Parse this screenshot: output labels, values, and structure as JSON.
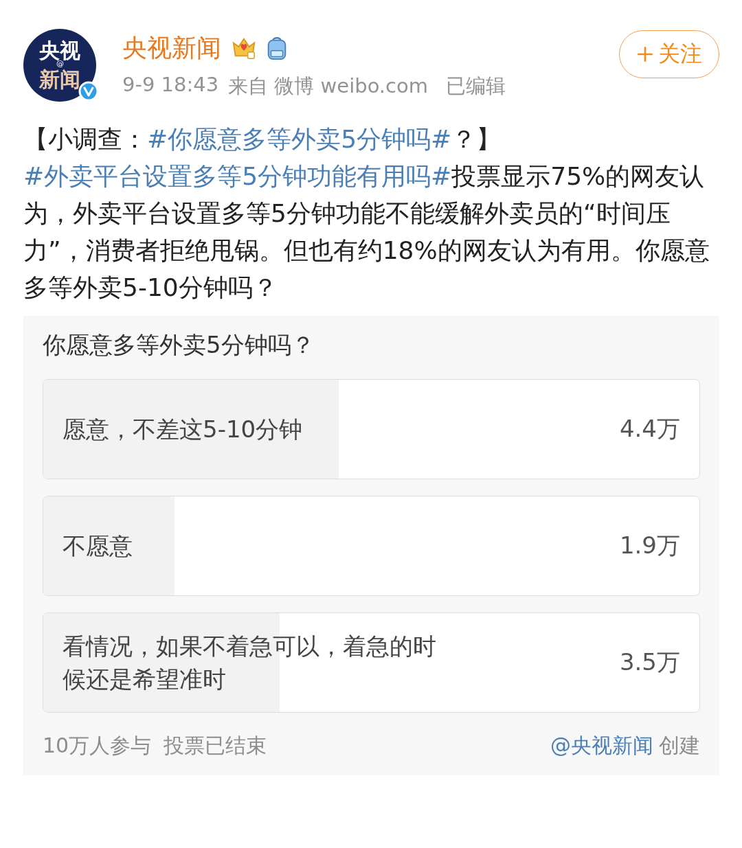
{
  "header": {
    "avatar": {
      "line_1": "央视",
      "line_2": "新闻",
      "mark": "@"
    },
    "name": "央视新闻",
    "time": "9-9 18:43",
    "source": "来自 微博 weibo.com",
    "edited": "已编辑",
    "follow_button": "关注"
  },
  "post": {
    "segments": [
      {
        "kind": "text",
        "text": "【小调查："
      },
      {
        "kind": "hashtag",
        "text": "#你愿意多等外卖5分钟吗#"
      },
      {
        "kind": "text",
        "text": "？】"
      },
      {
        "kind": "hashtag",
        "text": "#外卖平台设置多等5分钟功能有用吗#"
      },
      {
        "kind": "text",
        "text": "投票显示75%的网友认为，外卖平台设置多等5分钟功能不能缓解外卖员的“时间压力”，消费者拒绝甩锅。但也有约18%的网友认为有用。你愿意多等外卖5-10分钟吗？"
      }
    ]
  },
  "poll": {
    "question": "你愿意多等外卖5分钟吗？",
    "options": [
      {
        "label": "愿意，不差这5-10分钟",
        "level": 0.45,
        "count": "4.4万"
      },
      {
        "label": "不愿意",
        "level": 0.2,
        "count": "1.9万"
      },
      {
        "label": "看情况，如果不着急可以，着急的时候还是希望准时",
        "level": 0.36,
        "count": "3.5万"
      }
    ],
    "participants": "10万人参与",
    "status": "投票已结束",
    "creator": "@央视新闻",
    "created": "创建"
  }
}
